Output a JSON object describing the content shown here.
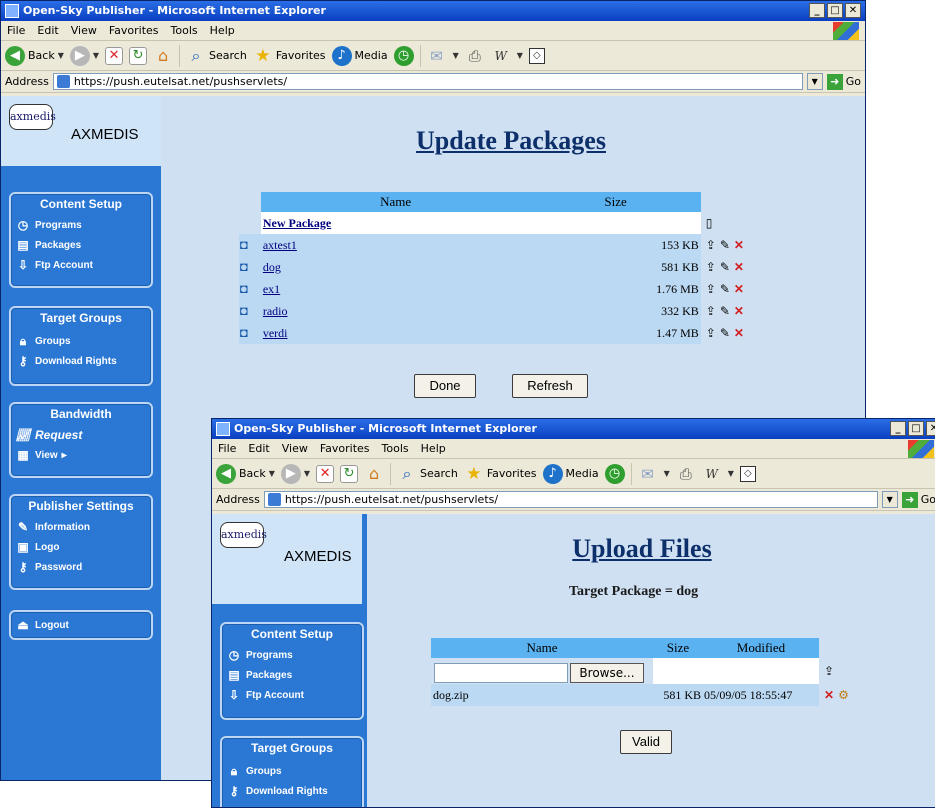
{
  "window1": {
    "title": "Open-Sky Publisher - Microsoft Internet Explorer",
    "menu": [
      "File",
      "Edit",
      "View",
      "Favorites",
      "Tools",
      "Help"
    ],
    "toolbar": {
      "back": "Back",
      "search": "Search",
      "favorites": "Favorites",
      "media": "Media"
    },
    "address_label": "Address",
    "address_url": "https://push.eutelsat.net/pushservlets/",
    "go_label": "Go",
    "page_title": "Update Packages",
    "table_headers": {
      "name": "Name",
      "size": "Size"
    },
    "new_package": "New Package",
    "rows": [
      {
        "name": "axtest1",
        "size": "153 KB"
      },
      {
        "name": "dog",
        "size": "581 KB"
      },
      {
        "name": "ex1",
        "size": "1.76 MB"
      },
      {
        "name": "radio",
        "size": "332 KB"
      },
      {
        "name": "verdi",
        "size": "1.47 MB"
      }
    ],
    "done_label": "Done",
    "refresh_label": "Refresh"
  },
  "sidebar": {
    "logo_badge": "axmedis",
    "logo_text": "AXMEDIS",
    "content_setup": "Content Setup",
    "programs": "Programs",
    "packages": "Packages",
    "ftp_account": "Ftp Account",
    "target_groups": "Target Groups",
    "groups": "Groups",
    "download_rights": "Download Rights",
    "bandwidth": "Bandwidth",
    "request": "Request",
    "view": "View",
    "publisher_settings": "Publisher Settings",
    "information": "Information",
    "logo": "Logo",
    "password": "Password",
    "logout": "Logout"
  },
  "window2": {
    "title": "Open-Sky Publisher - Microsoft Internet Explorer",
    "page_title": "Upload Files",
    "target_package": "Target Package = dog",
    "table_headers": {
      "name": "Name",
      "size": "Size",
      "modified": "Modified"
    },
    "browse_label": "Browse...",
    "file_row": {
      "name": "dog.zip",
      "size": "581 KB",
      "modified": "05/09/05 18:55:47"
    },
    "valid_label": "Valid"
  }
}
